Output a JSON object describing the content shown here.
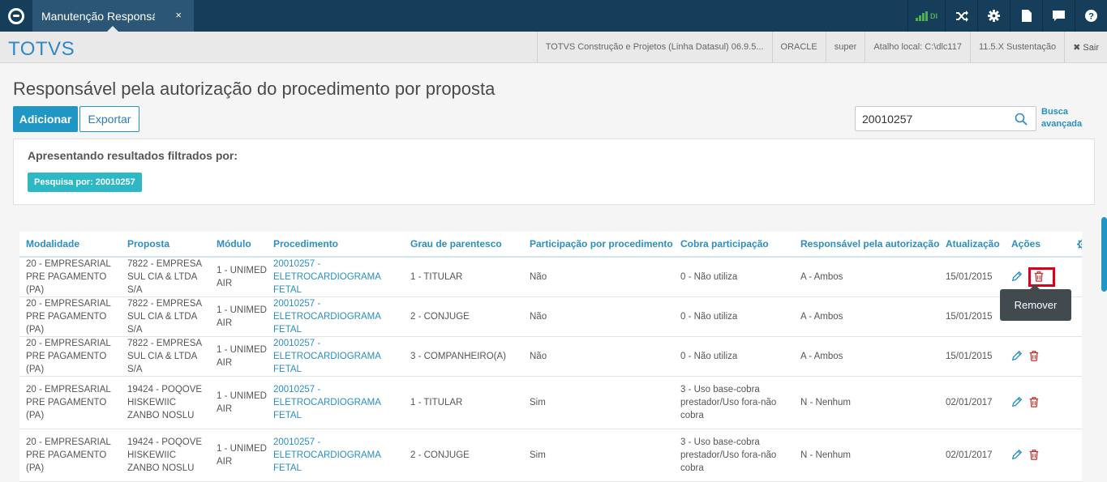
{
  "topbar": {
    "tab_title": "Manutenção Responsável",
    "tab_close": "×",
    "signal_label": "DI"
  },
  "header": {
    "brand": "TOTVS",
    "product": "TOTVS Construção e Projetos (Linha Datasul) 06.9.5...",
    "database": "ORACLE",
    "user": "super",
    "shortcut": "Atalho local: C:\\dlc117",
    "version": "11.5.X Sustentação",
    "logout": "✖ Sair"
  },
  "page": {
    "title": "Responsável pela autorização do procedimento por proposta",
    "add_button": "Adicionar",
    "export_button": "Exportar",
    "search_value": "20010257",
    "advanced_search": [
      "Busca",
      "avançada"
    ],
    "filter_title": "Apresentando resultados filtrados por:",
    "filter_tag": "Pesquisa por: 20010257"
  },
  "table": {
    "headers": [
      "Modalidade",
      "Proposta",
      "Módulo",
      "Procedimento",
      "Grau de parentesco",
      "Participação por procedimento",
      "Cobra participação",
      "Responsável pela autorização",
      "Atualização",
      "Ações"
    ],
    "rows": [
      {
        "modalidade": "20 - EMPRESARIAL PRE PAGAMENTO (PA)",
        "proposta": "7822 - EMPRESA SUL CIA & LTDA S/A",
        "modulo": "1 - UNIMED AIR",
        "procedimento": "20010257 - ELETROCARDIOGRAMA FETAL",
        "grau": "1 - TITULAR",
        "participacao": "Não",
        "cobra": "0 - Não utiliza",
        "responsavel": "A - Ambos",
        "atualizacao": "15/01/2015"
      },
      {
        "modalidade": "20 - EMPRESARIAL PRE PAGAMENTO (PA)",
        "proposta": "7822 - EMPRESA SUL CIA & LTDA S/A",
        "modulo": "1 - UNIMED AIR",
        "procedimento": "20010257 - ELETROCARDIOGRAMA FETAL",
        "grau": "2 - CONJUGE",
        "participacao": "Não",
        "cobra": "0 - Não utiliza",
        "responsavel": "A - Ambos",
        "atualizacao": "15/01/2015"
      },
      {
        "modalidade": "20 - EMPRESARIAL PRE PAGAMENTO (PA)",
        "proposta": "7822 - EMPRESA SUL CIA & LTDA S/A",
        "modulo": "1 - UNIMED AIR",
        "procedimento": "20010257 - ELETROCARDIOGRAMA FETAL",
        "grau": "3 - COMPANHEIRO(A)",
        "participacao": "Não",
        "cobra": "0 - Não utiliza",
        "responsavel": "A - Ambos",
        "atualizacao": "15/01/2015"
      },
      {
        "modalidade": "20 - EMPRESARIAL PRE PAGAMENTO (PA)",
        "proposta": "19424 - POQOVE HISKEWIIC ZANBO NOSLU",
        "modulo": "1 - UNIMED AIR",
        "procedimento": "20010257 - ELETROCARDIOGRAMA FETAL",
        "grau": "1 - TITULAR",
        "participacao": "Sim",
        "cobra": "3 - Uso base-cobra prestador/Uso fora-não cobra",
        "responsavel": "N - Nenhum",
        "atualizacao": "02/01/2017"
      },
      {
        "modalidade": "20 - EMPRESARIAL PRE PAGAMENTO (PA)",
        "proposta": "19424 - POQOVE HISKEWIIC ZANBO NOSLU",
        "modulo": "1 - UNIMED AIR",
        "procedimento": "20010257 - ELETROCARDIOGRAMA FETAL",
        "grau": "2 - CONJUGE",
        "participacao": "Sim",
        "cobra": "3 - Uso base-cobra prestador/Uso fora-não cobra",
        "responsavel": "N - Nenhum",
        "atualizacao": "02/01/2017"
      }
    ]
  },
  "tooltip": "Remover",
  "colors": {
    "topbar": "#163e5b",
    "accent": "#1f96c3",
    "link": "#2a8fc0",
    "tag": "#2eb8c6",
    "delete": "#c9302c",
    "highlight": "#d9001b"
  }
}
